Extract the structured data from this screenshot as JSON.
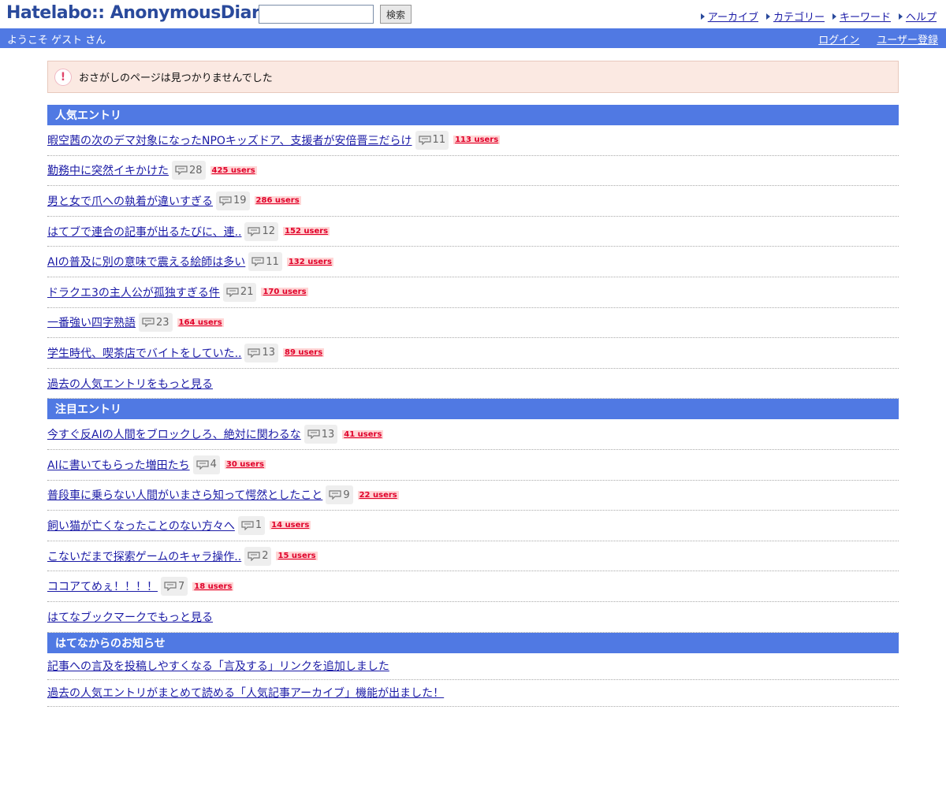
{
  "header": {
    "logo": "Hatelabo:: AnonymousDiary",
    "search_placeholder": "",
    "search_button": "検索",
    "nav": [
      "アーカイブ",
      "カテゴリー",
      "キーワード",
      "ヘルプ"
    ]
  },
  "subbar": {
    "welcome": "ようこそ ゲスト さん",
    "login": "ログイン",
    "register": "ユーザー登録"
  },
  "notice": {
    "icon": "!",
    "text": "おさがしのページは見つかりませんでした"
  },
  "popular": {
    "title": "人気エントリ",
    "entries": [
      {
        "title": "暇空茜の次のデマ対象になったNPOキッズドア、支援者が安倍晋三だらけ",
        "comments": "11",
        "users": "113 users"
      },
      {
        "title": "勤務中に突然イキかけた",
        "comments": "28",
        "users": "425 users"
      },
      {
        "title": "男と女で爪への執着が違いすぎる",
        "comments": "19",
        "users": "286 users"
      },
      {
        "title": "はてブで連合の記事が出るたびに、連..",
        "comments": "12",
        "users": "152 users"
      },
      {
        "title": "AIの普及に別の意味で震える絵師は多い",
        "comments": "11",
        "users": "132 users"
      },
      {
        "title": "ドラクエ3の主人公が孤独すぎる件",
        "comments": "21",
        "users": "170 users"
      },
      {
        "title": "一番強い四字熟語",
        "comments": "23",
        "users": "164 users"
      },
      {
        "title": "学生時代、喫茶店でバイトをしていた..",
        "comments": "13",
        "users": "89 users"
      }
    ],
    "more": "過去の人気エントリをもっと見る"
  },
  "featured": {
    "title": "注目エントリ",
    "entries": [
      {
        "title": "今すぐ反AIの人間をブロックしろ、絶対に関わるな",
        "comments": "13",
        "users": "41 users"
      },
      {
        "title": "AIに書いてもらった増田たち",
        "comments": "4",
        "users": "30 users"
      },
      {
        "title": "普段車に乗らない人間がいまさら知って愕然としたこと",
        "comments": "9",
        "users": "22 users"
      },
      {
        "title": "飼い猫が亡くなったことのない方々へ",
        "comments": "1",
        "users": "14 users"
      },
      {
        "title": "こないだまで探索ゲームのキャラ操作..",
        "comments": "2",
        "users": "15 users"
      },
      {
        "title": "ココアてめぇ！！！！",
        "comments": "7",
        "users": "18 users"
      }
    ],
    "more": "はてなブックマークでもっと見る"
  },
  "news": {
    "title": "はてなからのお知らせ",
    "items": [
      "記事への言及を投稿しやすくなる「言及する」リンクを追加しました",
      "過去の人気エントリがまとめて読める「人気記事アーカイブ」機能が出ました！"
    ]
  },
  "colors": {
    "accent": "#5079e3",
    "link": "#1a1aa6",
    "users": "#e0002a",
    "notice_bg": "#fbe9e2"
  }
}
